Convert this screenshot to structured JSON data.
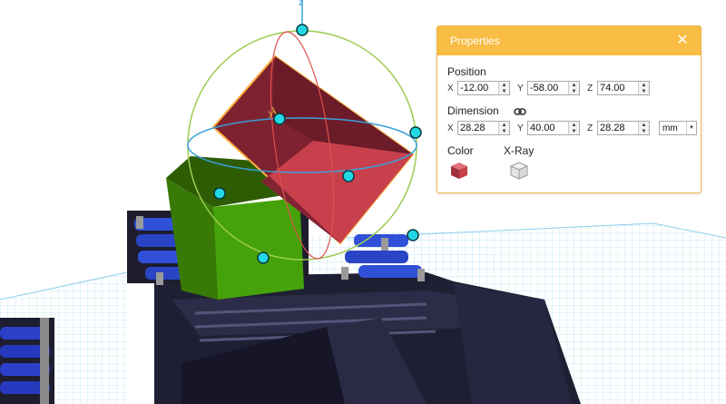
{
  "viewport": {
    "gizmo_axis_label": "z",
    "local_axis_label": "y",
    "colors": {
      "grid_line": "#9fd6f0",
      "grid_bg": "#ffffff",
      "selected_cube": "#c6404c",
      "green_block": "#3f9c06",
      "handle": "#22d8e6",
      "printer_body": "#1f1f33",
      "rotate_ring_green": "#9ccc50",
      "rotate_ring_blue": "#3aa0dc",
      "rotate_ring_red": "#e05050",
      "selection_outline": "#ffb040"
    }
  },
  "properties": {
    "title": "Properties",
    "close_icon": "close-icon",
    "position": {
      "label": "Position",
      "x_label": "X",
      "x_value": "-12.00",
      "y_label": "Y",
      "y_value": "-58.00",
      "z_label": "Z",
      "z_value": "74.00"
    },
    "dimension": {
      "label": "Dimension",
      "lock_icon": "link-icon",
      "x_label": "X",
      "x_value": "28.28",
      "y_label": "Y",
      "y_value": "40.00",
      "z_label": "Z",
      "z_value": "28.28",
      "unit": "mm"
    },
    "color": {
      "label": "Color",
      "value": "#c6404c"
    },
    "xray": {
      "label": "X-Ray"
    }
  }
}
